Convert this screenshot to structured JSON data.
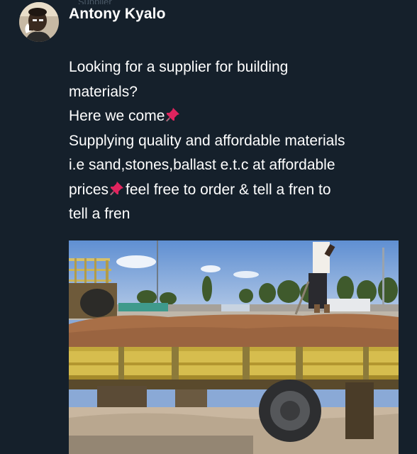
{
  "top_cut_text": "Supplier",
  "post": {
    "author_name": "Antony Kyalo",
    "text_lines": [
      "Looking for a supplier for building",
      "materials?",
      "Here we come",
      "Supplying quality and affordable materials",
      "i.e sand,stones,ballast e.t.c at affordable",
      "prices",
      "feel free to order & tell a fren to",
      "tell a fren"
    ],
    "pin_icon": "pushpin-icon"
  },
  "colors": {
    "background": "#15202b",
    "text": "#ffffff",
    "pin": "#e0245e"
  }
}
